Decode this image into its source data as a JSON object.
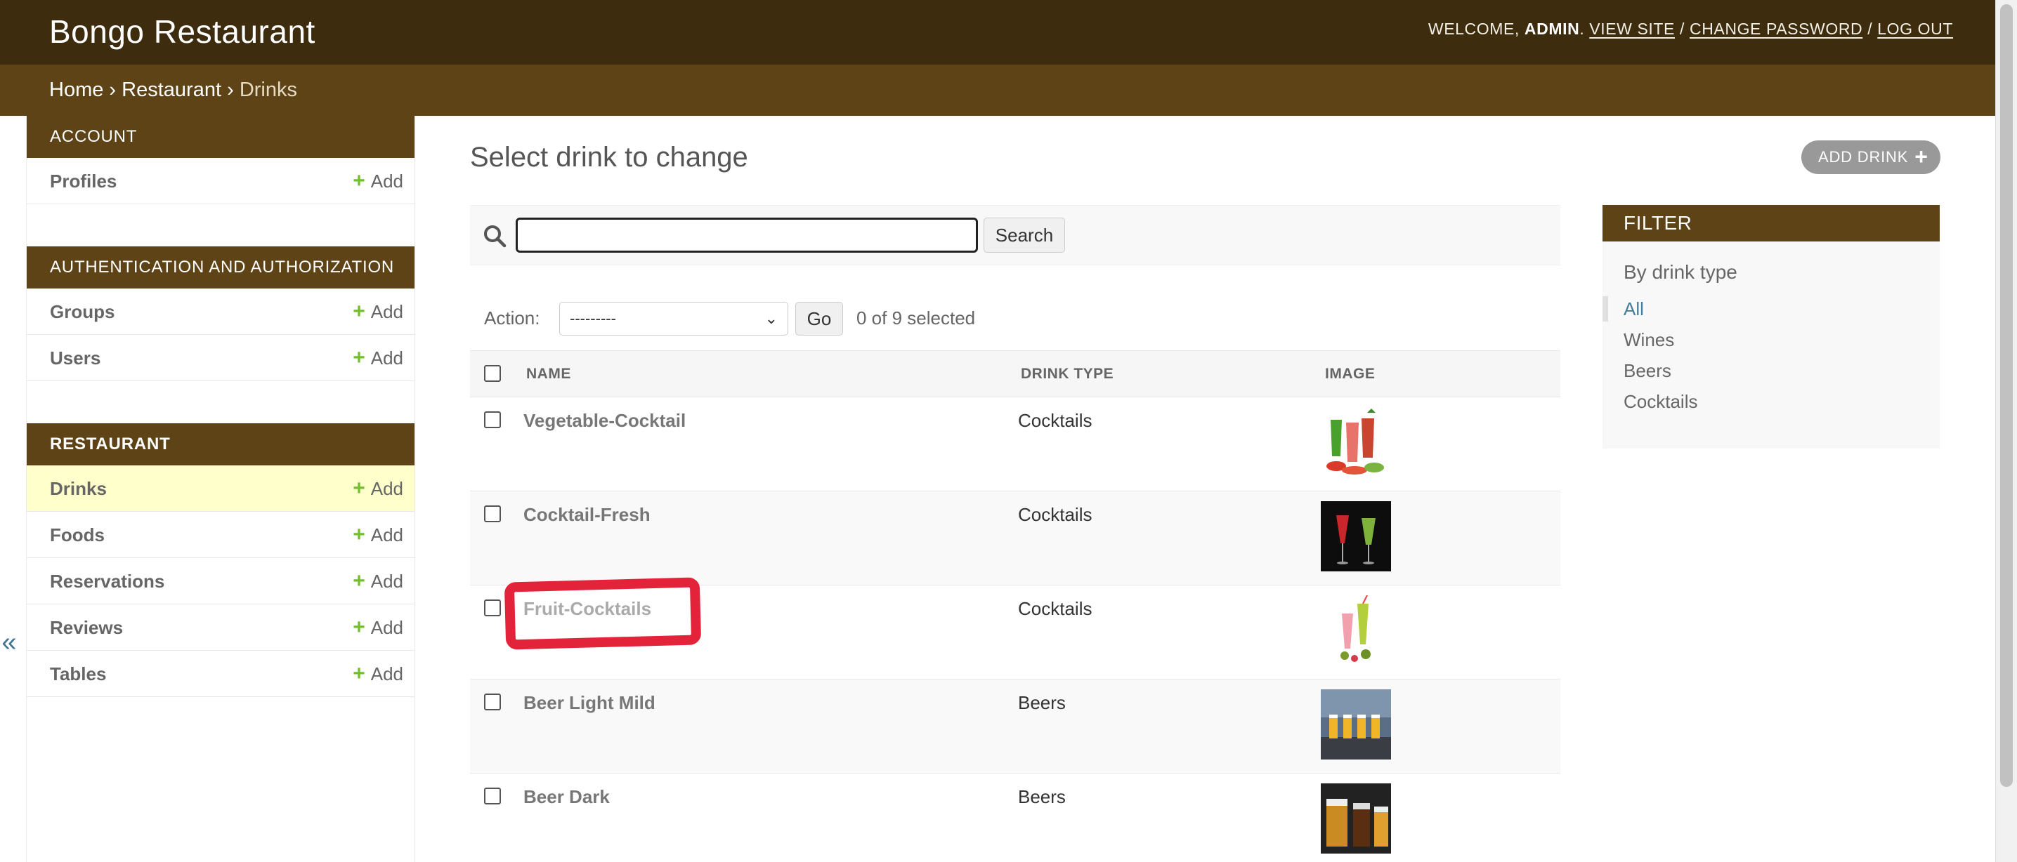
{
  "header": {
    "site_name": "Bongo Restaurant",
    "welcome": "WELCOME,",
    "username": "ADMIN",
    "view_site": "VIEW SITE",
    "change_password": "CHANGE PASSWORD",
    "log_out": "LOG OUT",
    "separator": "/"
  },
  "breadcrumbs": [
    "Home",
    "Restaurant",
    "Drinks"
  ],
  "breadcrumb_sep": "›",
  "sidebar": {
    "toggle": "«",
    "add_label": "Add",
    "apps": [
      {
        "caption": "ACCOUNT",
        "models": [
          "Profiles"
        ]
      },
      {
        "caption": "AUTHENTICATION AND AUTHORIZATION",
        "models": [
          "Groups",
          "Users"
        ]
      },
      {
        "caption": "RESTAURANT",
        "models": [
          "Drinks",
          "Foods",
          "Reservations",
          "Reviews",
          "Tables"
        ],
        "selected": "Drinks"
      }
    ]
  },
  "main": {
    "title": "Select drink to change",
    "add_button": "ADD DRINK",
    "search_value": "",
    "search_button": "Search",
    "action_label": "Action:",
    "action_selected": "---------",
    "go_button": "Go",
    "selected_count": "0 of 9 selected",
    "columns": [
      "NAME",
      "DRINK TYPE",
      "IMAGE"
    ],
    "rows": [
      {
        "name": "Vegetable-Cocktail",
        "type": "Cocktails"
      },
      {
        "name": "Cocktail-Fresh",
        "type": "Cocktails"
      },
      {
        "name": "Fruit-Cocktails",
        "type": "Cocktails"
      },
      {
        "name": "Beer Light Mild",
        "type": "Beers"
      },
      {
        "name": "Beer Dark",
        "type": "Beers"
      }
    ]
  },
  "filter": {
    "title": "FILTER",
    "subtitle": "By drink type",
    "options": [
      "All",
      "Wines",
      "Beers",
      "Cocktails"
    ],
    "active": "All"
  },
  "colors": {
    "header_bg": "#3d2c0e",
    "breadcrumb_bg": "#5d4315",
    "add_green": "#70bf2b",
    "link_blue": "#447e9b",
    "annotation_red": "#e3233a",
    "selected_row": "#ffffcc"
  }
}
